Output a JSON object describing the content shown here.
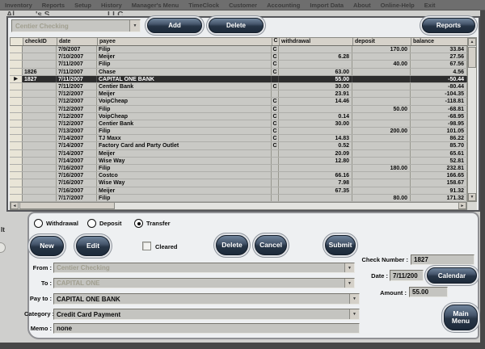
{
  "menu_bar": {
    "items": [
      "Inventory",
      "Reports",
      "Setup",
      "History",
      "Manager's Menu",
      "TimeClock",
      "Customer",
      "Accounting",
      "Import Data",
      "About",
      "Online-Help",
      "Exit"
    ]
  },
  "background_window": {
    "obscured_title_fragments": [
      "Al",
      "'s S",
      "LLC"
    ],
    "left_edge_fragment": "It"
  },
  "register": {
    "account_selector": {
      "value": "Centier Checking",
      "disabled": true
    },
    "add_label": "Add",
    "delete_label": "Delete",
    "reports_label": "Reports",
    "table": {
      "columns": [
        "checkID",
        "date",
        "payee",
        "C",
        "withdrawal",
        "deposit",
        "balance"
      ],
      "selected_row_index": 4,
      "rows": [
        {
          "checkID": "",
          "date": "7/9/2007",
          "payee": "Filip",
          "c": "C",
          "withdrawal": "",
          "deposit": "170.00",
          "balance": "33.84"
        },
        {
          "checkID": "",
          "date": "7/10/2007",
          "payee": "Meijer",
          "c": "C",
          "withdrawal": "6.28",
          "deposit": "",
          "balance": "27.56"
        },
        {
          "checkID": "",
          "date": "7/11/2007",
          "payee": "Filip",
          "c": "C",
          "withdrawal": "",
          "deposit": "40.00",
          "balance": "67.56"
        },
        {
          "checkID": "1826",
          "date": "7/11/2007",
          "payee": "Chase",
          "c": "C",
          "withdrawal": "63.00",
          "deposit": "",
          "balance": "4.56"
        },
        {
          "checkID": "1827",
          "date": "7/11/2007",
          "payee": "CAPITAL ONE BANK",
          "c": "",
          "withdrawal": "55.00",
          "deposit": "",
          "balance": "-50.44"
        },
        {
          "checkID": "",
          "date": "7/11/2007",
          "payee": "Centier Bank",
          "c": "C",
          "withdrawal": "30.00",
          "deposit": "",
          "balance": "-80.44"
        },
        {
          "checkID": "",
          "date": "7/12/2007",
          "payee": "Meijer",
          "c": "",
          "withdrawal": "23.91",
          "deposit": "",
          "balance": "-104.35"
        },
        {
          "checkID": "",
          "date": "7/12/2007",
          "payee": "VoipCheap",
          "c": "C",
          "withdrawal": "14.46",
          "deposit": "",
          "balance": "-118.81"
        },
        {
          "checkID": "",
          "date": "7/12/2007",
          "payee": "Filip",
          "c": "C",
          "withdrawal": "",
          "deposit": "50.00",
          "balance": "-68.81"
        },
        {
          "checkID": "",
          "date": "7/12/2007",
          "payee": "VoipCheap",
          "c": "C",
          "withdrawal": "0.14",
          "deposit": "",
          "balance": "-68.95"
        },
        {
          "checkID": "",
          "date": "7/12/2007",
          "payee": "Centier Bank",
          "c": "C",
          "withdrawal": "30.00",
          "deposit": "",
          "balance": "-98.95"
        },
        {
          "checkID": "",
          "date": "7/13/2007",
          "payee": "Filip",
          "c": "C",
          "withdrawal": "",
          "deposit": "200.00",
          "balance": "101.05"
        },
        {
          "checkID": "",
          "date": "7/14/2007",
          "payee": "TJ Maxx",
          "c": "C",
          "withdrawal": "14.83",
          "deposit": "",
          "balance": "86.22"
        },
        {
          "checkID": "",
          "date": "7/14/2007",
          "payee": "Factory Card and Party Outlet",
          "c": "C",
          "withdrawal": "0.52",
          "deposit": "",
          "balance": "85.70"
        },
        {
          "checkID": "",
          "date": "7/14/2007",
          "payee": "Meijer",
          "c": "",
          "withdrawal": "20.09",
          "deposit": "",
          "balance": "65.61"
        },
        {
          "checkID": "",
          "date": "7/14/2007",
          "payee": "Wise Way",
          "c": "",
          "withdrawal": "12.80",
          "deposit": "",
          "balance": "52.81"
        },
        {
          "checkID": "",
          "date": "7/16/2007",
          "payee": "Filip",
          "c": "",
          "withdrawal": "",
          "deposit": "180.00",
          "balance": "232.81"
        },
        {
          "checkID": "",
          "date": "7/16/2007",
          "payee": "Costco",
          "c": "",
          "withdrawal": "66.16",
          "deposit": "",
          "balance": "166.65"
        },
        {
          "checkID": "",
          "date": "7/16/2007",
          "payee": "Wise Way",
          "c": "",
          "withdrawal": "7.98",
          "deposit": "",
          "balance": "158.67"
        },
        {
          "checkID": "",
          "date": "7/16/2007",
          "payee": "Meijer",
          "c": "",
          "withdrawal": "67.35",
          "deposit": "",
          "balance": "91.32"
        },
        {
          "checkID": "",
          "date": "7/17/2007",
          "payee": "Filip",
          "c": "",
          "withdrawal": "",
          "deposit": "80.00",
          "balance": "171.32"
        }
      ]
    }
  },
  "form": {
    "radios": [
      {
        "label": "Withdrawal",
        "selected": false
      },
      {
        "label": "Deposit",
        "selected": false
      },
      {
        "label": "Transfer",
        "selected": true
      }
    ],
    "buttons": {
      "new": "New",
      "edit": "Edit",
      "delete": "Delete",
      "cancel": "Cancel",
      "submit": "Submit",
      "calendar": "Calendar",
      "main_menu": "Main Menu"
    },
    "cleared": {
      "label": "Cleared",
      "checked": false
    },
    "fields": {
      "from": {
        "label": "From :",
        "value": "Centier Checking",
        "disabled": true
      },
      "to": {
        "label": "To :",
        "value": "CAPITAL ONE",
        "disabled": true
      },
      "pay_to": {
        "label": "Pay to :",
        "value": "CAPITAL ONE BANK",
        "disabled": false
      },
      "category": {
        "label": "Category :",
        "value": "Credit Card Payment",
        "disabled": false
      },
      "memo": {
        "label": "Memo :",
        "value": "none",
        "disabled": false
      },
      "check_number": {
        "label": "Check Number :",
        "value": "1827"
      },
      "date": {
        "label": "Date :",
        "value": "7/11/200"
      },
      "amount": {
        "label": "Amount :",
        "value": "55.00"
      }
    }
  },
  "colors": {
    "menubar_bg": "#6e6e6e",
    "panel_bg": "#eceef0",
    "button_dark": "#273546",
    "table_row_bg": "#c9c9c5",
    "table_header_bg": "#d6d2ca",
    "selected_row_bg": "#2d2d2d",
    "selector_cell_bg": "#e9e5d7",
    "frame_dark": "#474747"
  }
}
